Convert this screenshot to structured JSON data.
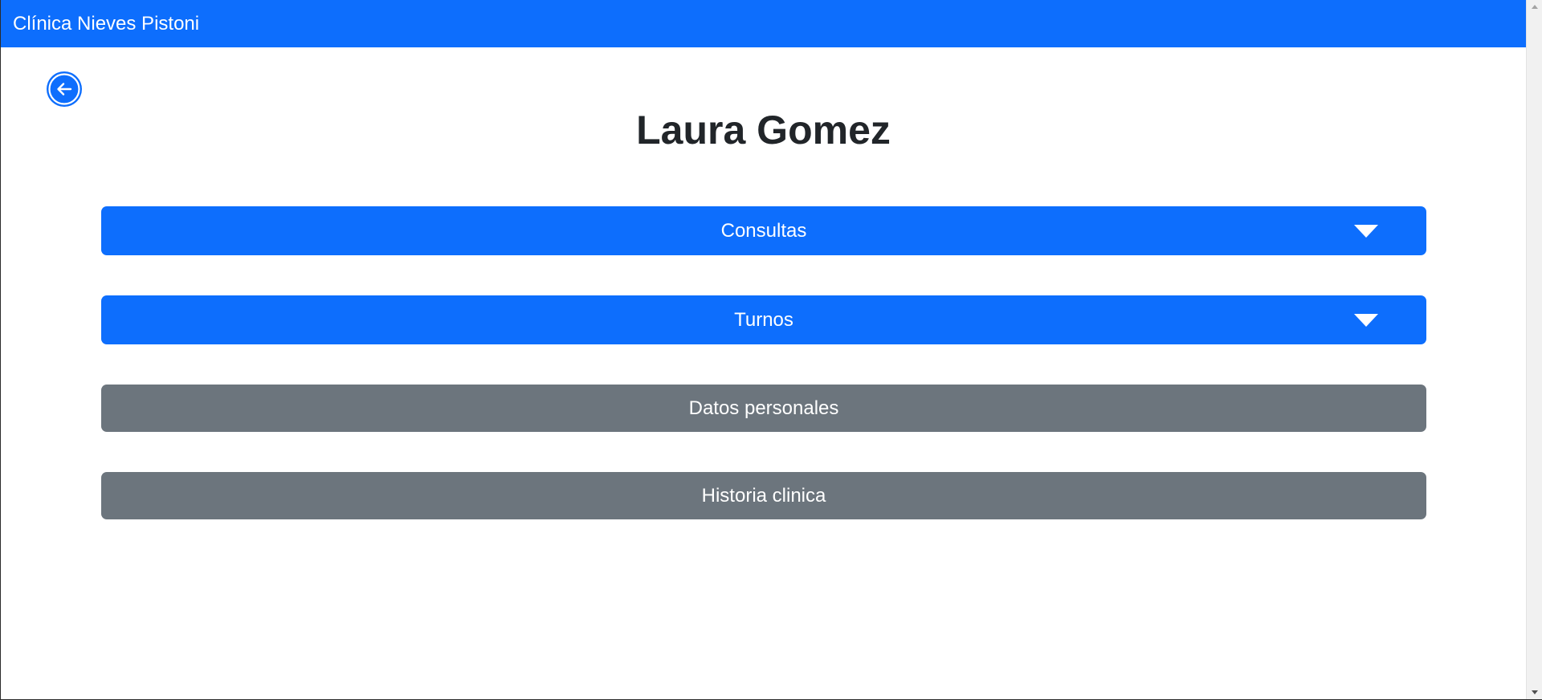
{
  "navbar": {
    "brand": "Clínica Nieves Pistoni",
    "color": "#0d6efd"
  },
  "back_button": {
    "icon": "arrow-left-circle-icon"
  },
  "patient": {
    "name": "Laura Gomez"
  },
  "sections": {
    "consultas": {
      "label": "Consultas",
      "icon": "caret-down-icon",
      "color": "#0d6efd"
    },
    "turnos": {
      "label": "Turnos",
      "icon": "caret-down-icon",
      "color": "#0d6efd"
    },
    "datos_personales": {
      "label": "Datos personales",
      "color": "#6c757d"
    },
    "historia_clinica": {
      "label": "Historia clinica",
      "color": "#6c757d"
    }
  }
}
